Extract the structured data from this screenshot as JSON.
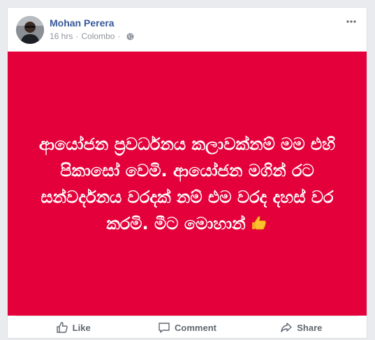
{
  "post": {
    "author": "Mohan Perera",
    "time": "16 hrs",
    "separator": "·",
    "location": "Colombo",
    "visibility_icon": "globe-icon",
    "options_icon": "more-options-icon",
    "background_color": "#e4003b",
    "text_color": "#ffffff",
    "text": "ආයෝජන ප්‍රවර්ධනය කලාවක්නම් මම එහි පිකාසෝ වෙමි. ආයෝජන මගින් රට සන්වර්දනය වරදක් නම් එම වරද දහස් වර කරමි. මීට මොහාන්",
    "emoji_icon": "thumbs-up-emoji-icon"
  },
  "actions": {
    "like": "Like",
    "comment": "Comment",
    "share": "Share"
  },
  "colors": {
    "author_link": "#365899",
    "meta": "#90949c",
    "action_text": "#606770"
  }
}
